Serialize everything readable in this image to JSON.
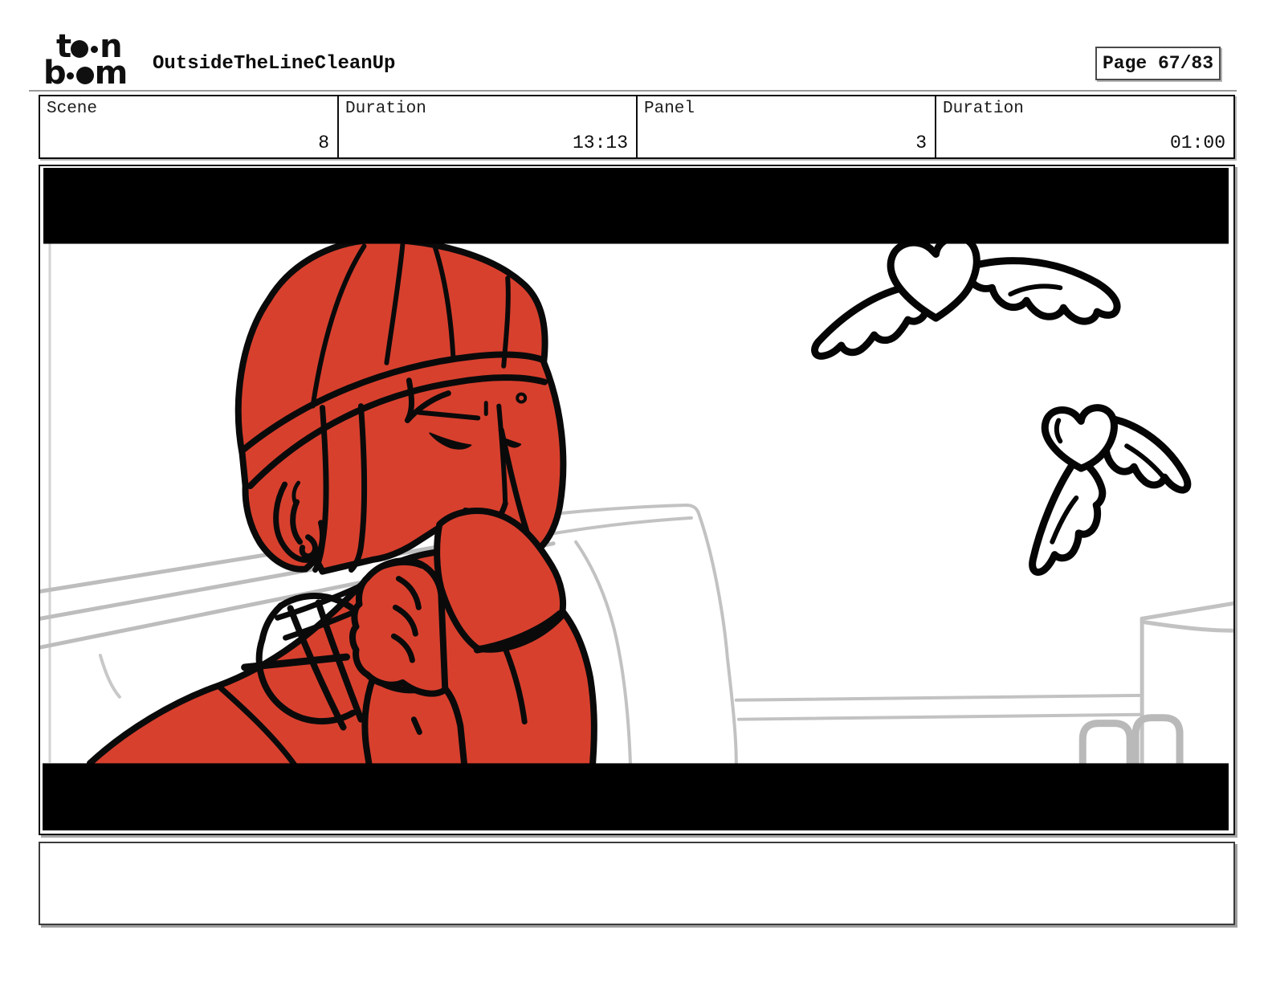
{
  "header": {
    "brand": {
      "alt": "toon boom",
      "top": {
        "left": "t",
        "right": "n"
      },
      "bottom": {
        "left": "b",
        "right": "m"
      }
    },
    "title": "OutsideTheLineCleanUp",
    "page_label": "Page 67/83"
  },
  "info_bar": {
    "cells": [
      {
        "label": "Scene",
        "value": "8"
      },
      {
        "label": "Duration",
        "value": "13:13"
      },
      {
        "label": "Panel",
        "value": "3"
      },
      {
        "label": "Duration",
        "value": "01:00"
      }
    ]
  },
  "storyboard_panel": {
    "description": "Hand-drawn storyboard frame: a character in a red beanie sips from a mug, eyes half closed; two winged hearts fly in the sky at right; light-gray outlines of a trailer truck in the background; black letterbox bars top and bottom.",
    "letterbox": true,
    "art_colors": {
      "character_red": "#d8402e",
      "outline_black": "#000000",
      "background_gray": "#c0c0c0",
      "letterbox_black": "#000000"
    }
  },
  "caption": {
    "text": ""
  }
}
